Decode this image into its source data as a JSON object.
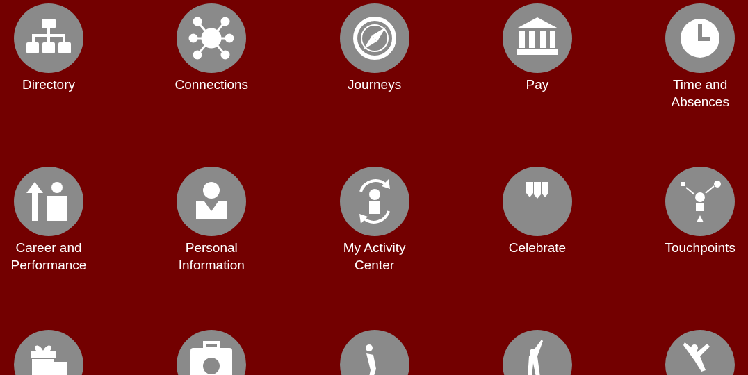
{
  "tiles": [
    {
      "label": "Directory"
    },
    {
      "label": "Connections"
    },
    {
      "label": "Journeys"
    },
    {
      "label": "Pay"
    },
    {
      "label": "Time and Absences"
    },
    {
      "label": "Career and Performance"
    },
    {
      "label": "Personal Information"
    },
    {
      "label": "My Activity Center"
    },
    {
      "label": "Celebrate"
    },
    {
      "label": "Touchpoints"
    }
  ]
}
